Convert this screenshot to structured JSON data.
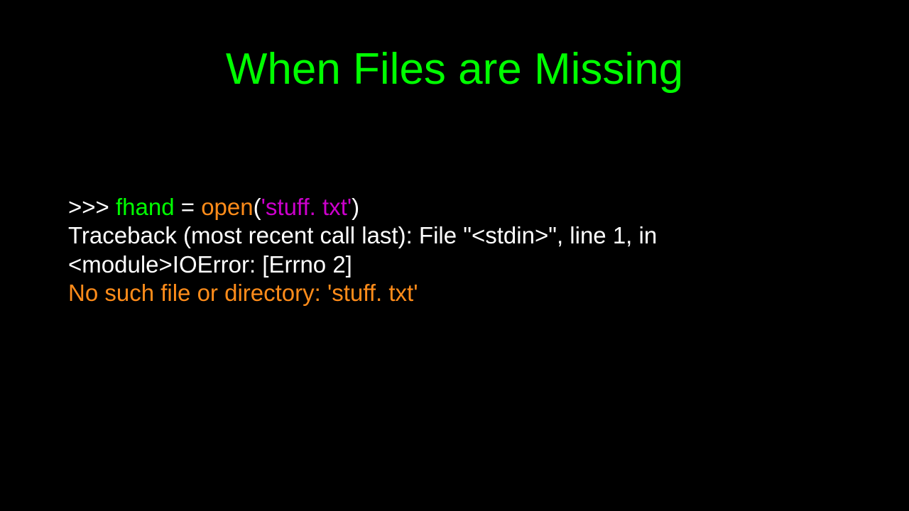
{
  "title": "When Files are Missing",
  "code": {
    "prompt": ">>> ",
    "var": "fhand",
    "assign": " = ",
    "func": "open",
    "paren_open": "(",
    "arg": "'stuff. txt'",
    "paren_close": ")"
  },
  "traceback": "Traceback (most recent call last):  File \"<stdin>\", line 1, in <module>IOError: [Errno 2]",
  "error": "No such file or directory: 'stuff. txt'"
}
